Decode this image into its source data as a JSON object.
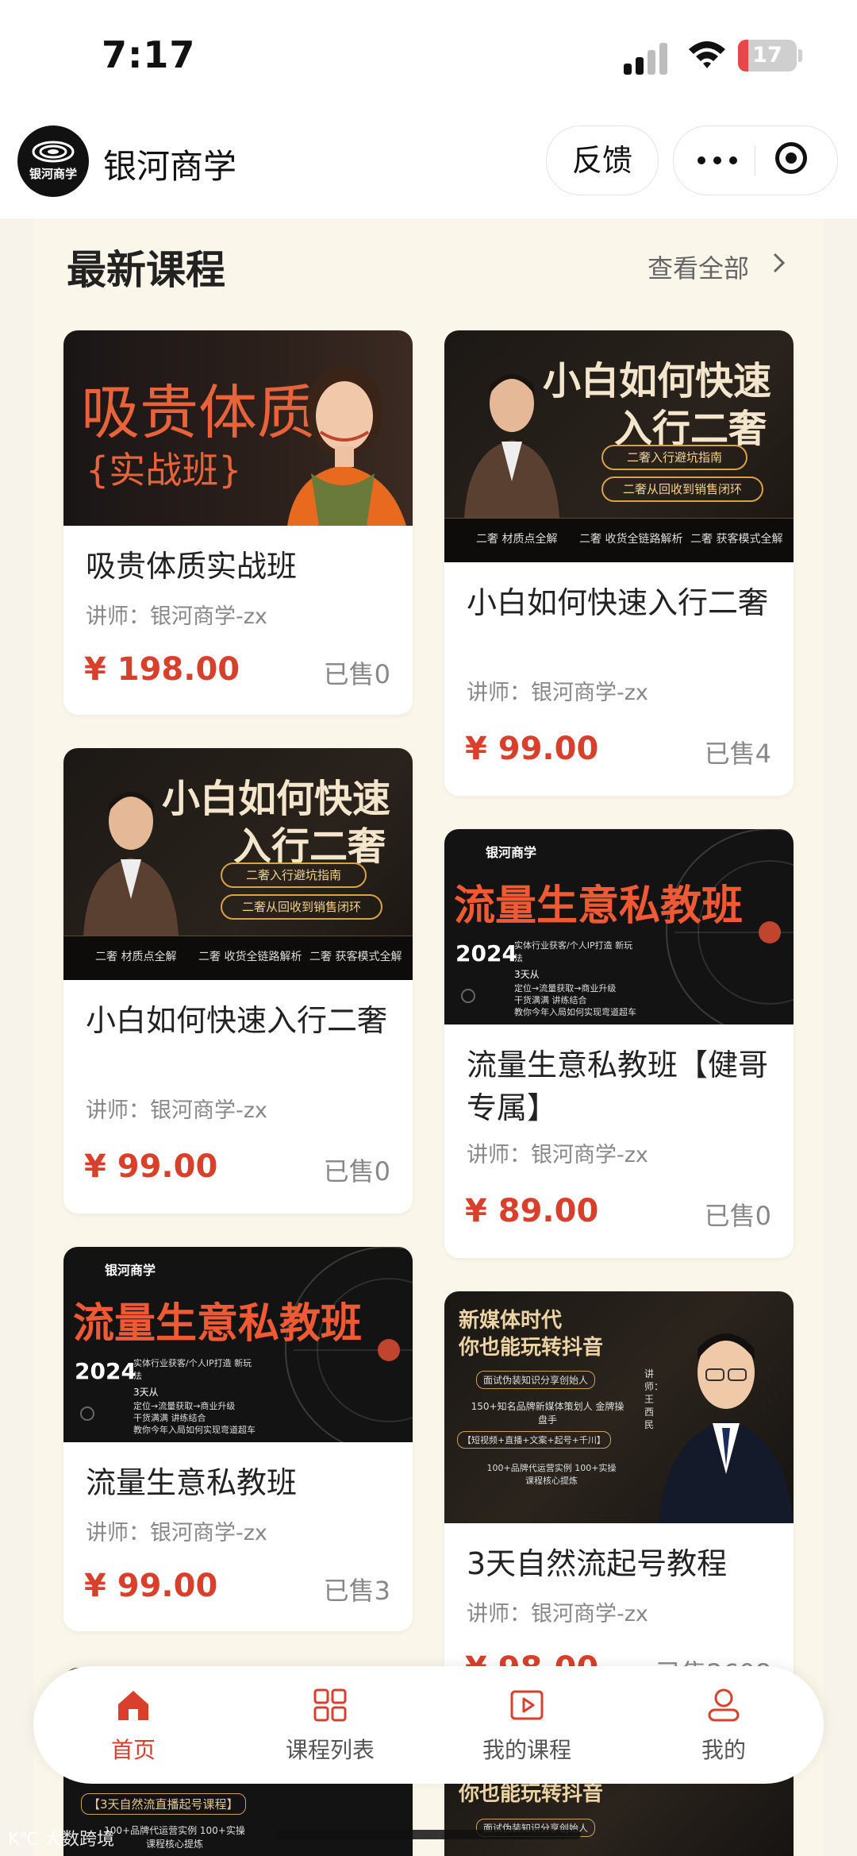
{
  "status_bar": {
    "time": "7:17",
    "battery": "17",
    "battery_level": 0.17
  },
  "nav": {
    "title": "银河商学",
    "logo_text": "银河商学",
    "feedback_label": "反馈"
  },
  "section": {
    "title": "最新课程",
    "view_all_label": "查看全部"
  },
  "colors": {
    "accent": "#d9402c",
    "panel_bg": "#fbf6ea",
    "page_bg": "#f7f3ea"
  },
  "thumbs": {
    "luxury": {
      "line1": "吸贵体质",
      "line2": "{实战班}"
    },
    "newbie": {
      "line1": "小白如何快速",
      "line2": "入行二奢",
      "pill1": "二奢入行避坑指南",
      "pill2": "二奢从回收到销售闭环",
      "f1": "二奢 材质点全解",
      "f2": "二奢 收货全链路解析",
      "f3": "二奢 获客模式全解"
    },
    "traffic": {
      "brand": "银河商学",
      "title": "流量生意私教班",
      "year": "2024",
      "sub1": "实体行业获客/个人IP打造 新玩法",
      "sub2": "3天从",
      "sub3": "定位→流量获取→商业升级",
      "sub4": "干货满满 讲练结合",
      "sub5": "教你今年入局如何实现弯道超车"
    },
    "douyin": {
      "line1": "新媒体时代",
      "line2": "你也能玩转抖音",
      "p1": "面试伪装知识分享创始人",
      "p2": "150+知名品牌新媒体策划人 金牌操盘手",
      "p3": "【短视频+直播+文案+起号+千川】",
      "p4": "100+品牌代运营实例 100+实操课程核心提炼",
      "teacher": "讲师：王西民"
    }
  },
  "courses": [
    {
      "title": "吸贵体质实战班",
      "teacher": "讲师：银河商学-zx",
      "price": "¥ 198.00",
      "sold": "已售0"
    },
    {
      "title": "小白如何快速入行二奢",
      "teacher": "讲师：银河商学-zx",
      "price": "¥ 99.00",
      "sold": "已售4"
    },
    {
      "title": "小白如何快速入行二奢",
      "teacher": "讲师：银河商学-zx",
      "price": "¥ 99.00",
      "sold": "已售0"
    },
    {
      "title": "流量生意私教班【健哥专属】",
      "teacher": "讲师：银河商学-zx",
      "price": "¥ 89.00",
      "sold": "已售0"
    },
    {
      "title": "流量生意私教班",
      "teacher": "讲师：银河商学-zx",
      "price": "¥ 99.00",
      "sold": "已售3"
    },
    {
      "title": "3天自然流起号教程",
      "teacher": "讲师：银河商学-zx",
      "price": "¥ 98.00",
      "sold": "已售2608"
    }
  ],
  "partial_cards": {
    "left_tag": "【3天自然流直播起号课程】",
    "left_line": "100+品牌代运营实例 100+实操课程核心提炼"
  },
  "tabs": [
    {
      "label": "首页",
      "icon": "home-icon"
    },
    {
      "label": "课程列表",
      "icon": "grid-icon"
    },
    {
      "label": "我的课程",
      "icon": "play-icon"
    },
    {
      "label": "我的",
      "icon": "user-icon"
    }
  ],
  "watermark": "K℃ 大数跨境"
}
